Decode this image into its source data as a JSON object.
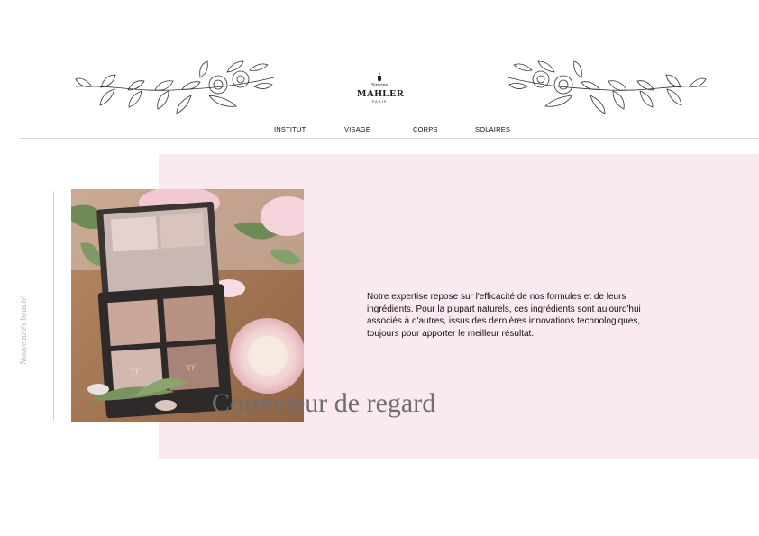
{
  "brand": {
    "first_name": "Simone",
    "last_name": "MAHLER",
    "city": "PARIS"
  },
  "nav": {
    "items": [
      {
        "label": "INSTITUT"
      },
      {
        "label": "VISAGE"
      },
      {
        "label": "CORPS"
      },
      {
        "label": "SOLAIRES"
      }
    ]
  },
  "side_label": "Nouveautés beauté",
  "main": {
    "description": "Notre expertise repose sur l'efficacité de nos formules et de leurs ingrédients. Pour la plupart naturels, ces ingrédients sont aujourd'hui associés à d'autres, issus des dernières innovations technologiques, toujours pour apporter le meilleur résultat.",
    "headline": "Correcteur de regard"
  },
  "colors": {
    "panel_bg": "#fbe9f1",
    "headline": "#6e6e6e",
    "side_label": "#b9b9b9"
  },
  "icons": {
    "left_ornament": "floral-branch-icon",
    "right_ornament": "floral-branch-icon",
    "logo_crest": "crest-icon"
  }
}
